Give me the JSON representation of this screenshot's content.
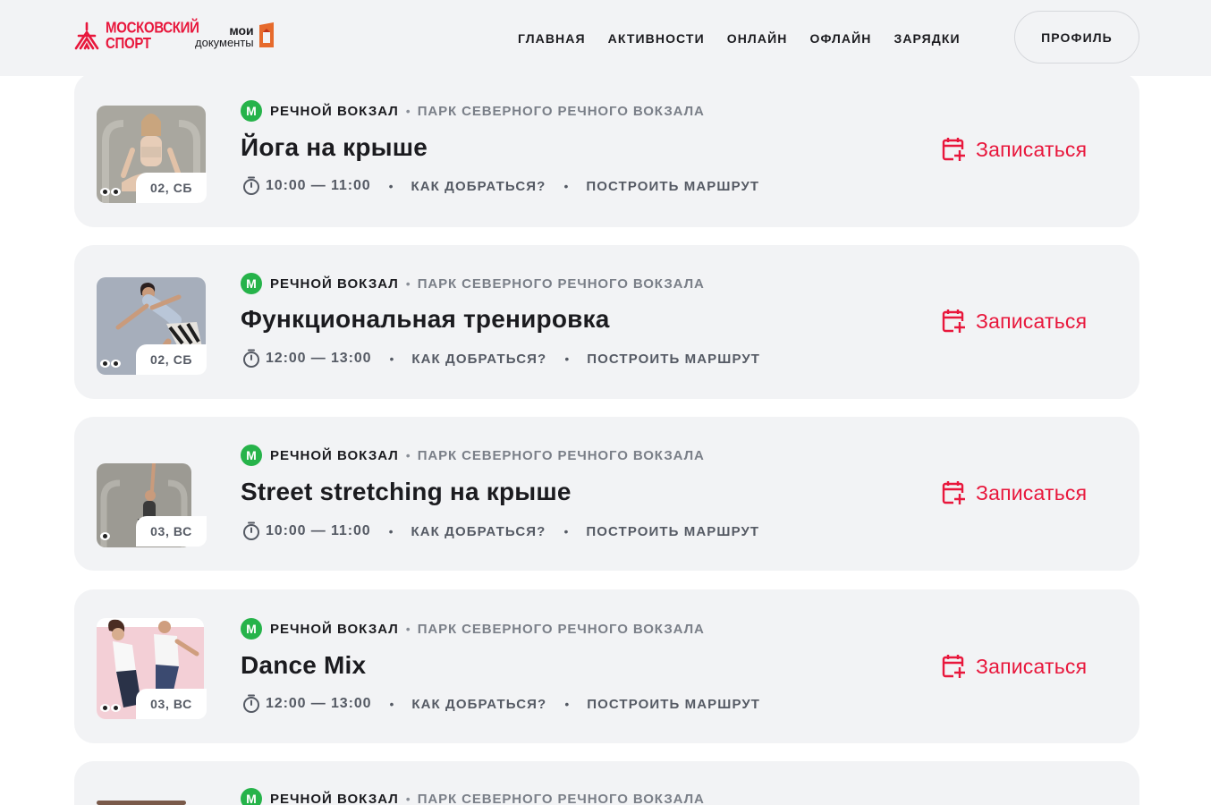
{
  "header": {
    "logo_moscow_sport": "МОСКОВСКИЙ СПОРТ",
    "logo_moscow_sport_lines": [
      "МОСКОВСКИЙ",
      "СПОРТ"
    ],
    "logo_my_docs_lines": [
      "мои",
      "документы"
    ],
    "nav": [
      "ГЛАВНАЯ",
      "АКТИВНОСТИ",
      "ОНЛАЙН",
      "ОФЛАЙН",
      "ЗАРЯДКИ"
    ],
    "profile": "ПРОФИЛЬ"
  },
  "colors": {
    "accent": "#e8173c",
    "metro": "#26b34a",
    "card_bg": "#f2f3f5",
    "header_bg": "#f2f3f5"
  },
  "icons": {
    "metro": "metro-m-icon",
    "timer": "stopwatch-icon",
    "signup": "calendar-plus-icon",
    "views": "eyes-icon"
  },
  "events": [
    {
      "metro_letter": "М",
      "station": "РЕЧНОЙ ВОКЗАЛ",
      "park": "ПАРК СЕВЕРНОГО РЕЧНОГО ВОКЗАЛА",
      "title": "Йога на крыше",
      "time": "10:00 — 11:00",
      "how_to_get": "КАК ДОБРАТЬСЯ?",
      "route": "ПОСТРОИТЬ МАРШРУТ",
      "date": "02, СБ",
      "signup": "Записаться"
    },
    {
      "metro_letter": "М",
      "station": "РЕЧНОЙ ВОКЗАЛ",
      "park": "ПАРК СЕВЕРНОГО РЕЧНОГО ВОКЗАЛА",
      "title": "Функциональная тренировка",
      "time": "12:00 — 13:00",
      "how_to_get": "КАК ДОБРАТЬСЯ?",
      "route": "ПОСТРОИТЬ МАРШРУТ",
      "date": "02, СБ",
      "signup": "Записаться"
    },
    {
      "metro_letter": "М",
      "station": "РЕЧНОЙ ВОКЗАЛ",
      "park": "ПАРК СЕВЕРНОГО РЕЧНОГО ВОКЗАЛА",
      "title": "Street stretching на крыше",
      "time": "10:00 — 11:00",
      "how_to_get": "КАК ДОБРАТЬСЯ?",
      "route": "ПОСТРОИТЬ МАРШРУТ",
      "date": "03, ВС",
      "signup": "Записаться"
    },
    {
      "metro_letter": "М",
      "station": "РЕЧНОЙ ВОКЗАЛ",
      "park": "ПАРК СЕВЕРНОГО РЕЧНОГО ВОКЗАЛА",
      "title": "Dance Mix",
      "time": "12:00 — 13:00",
      "how_to_get": "КАК ДОБРАТЬСЯ?",
      "route": "ПОСТРОИТЬ МАРШРУТ",
      "date": "03, ВС",
      "signup": "Записаться"
    },
    {
      "metro_letter": "М",
      "station": "РЕЧНОЙ ВОКЗАЛ",
      "park": "ПАРК СЕВЕРНОГО РЕЧНОГО ВОКЗАЛА"
    }
  ]
}
